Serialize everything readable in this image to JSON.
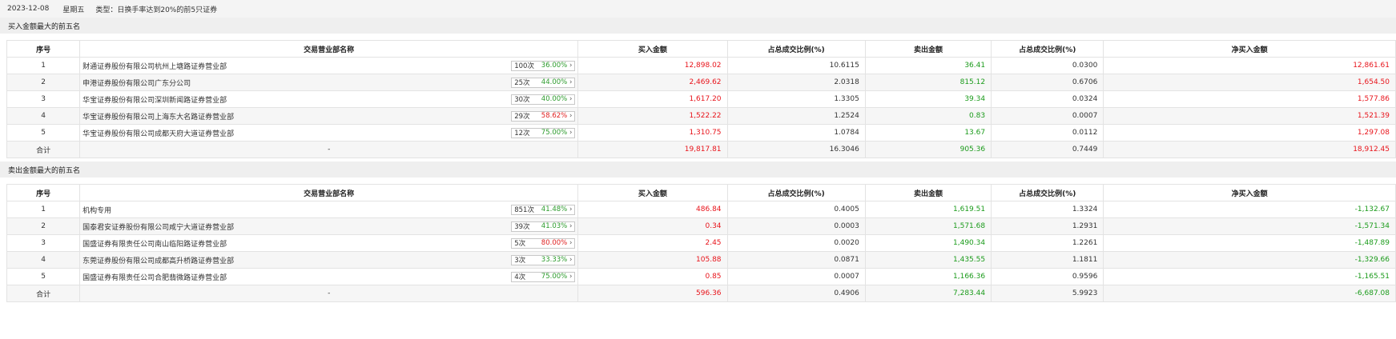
{
  "header": {
    "date": "2023-12-08",
    "weekday": "星期五",
    "type_label": "类型：",
    "type_value": "日换手率达到20%的前5只证券"
  },
  "columns": [
    "序号",
    "交易营业部名称",
    "买入金额",
    "占总成交比例(%)",
    "卖出金额",
    "占总成交比例(%)",
    "净买入金额"
  ],
  "buy": {
    "title": "买入金额最大的前五名",
    "rows": [
      {
        "idx": "1",
        "name": "财通证券股份有限公司杭州上塘路证券营业部",
        "count": "100次",
        "rate": "36.00%",
        "rate_color": "green",
        "buy": "12,898.02",
        "buy_pct": "10.6115",
        "sell": "36.41",
        "sell_pct": "0.0300",
        "net": "12,861.61",
        "net_color": "red"
      },
      {
        "idx": "2",
        "name": "申港证券股份有限公司广东分公司",
        "count": "25次",
        "rate": "44.00%",
        "rate_color": "green",
        "buy": "2,469.62",
        "buy_pct": "2.0318",
        "sell": "815.12",
        "sell_pct": "0.6706",
        "net": "1,654.50",
        "net_color": "red"
      },
      {
        "idx": "3",
        "name": "华宝证券股份有限公司深圳新闻路证券营业部",
        "count": "30次",
        "rate": "40.00%",
        "rate_color": "green",
        "buy": "1,617.20",
        "buy_pct": "1.3305",
        "sell": "39.34",
        "sell_pct": "0.0324",
        "net": "1,577.86",
        "net_color": "red"
      },
      {
        "idx": "4",
        "name": "华宝证券股份有限公司上海东大名路证券营业部",
        "count": "29次",
        "rate": "58.62%",
        "rate_color": "red",
        "buy": "1,522.22",
        "buy_pct": "1.2524",
        "sell": "0.83",
        "sell_pct": "0.0007",
        "net": "1,521.39",
        "net_color": "red"
      },
      {
        "idx": "5",
        "name": "华宝证券股份有限公司成都天府大道证券营业部",
        "count": "12次",
        "rate": "75.00%",
        "rate_color": "green",
        "buy": "1,310.75",
        "buy_pct": "1.0784",
        "sell": "13.67",
        "sell_pct": "0.0112",
        "net": "1,297.08",
        "net_color": "red"
      }
    ],
    "total": {
      "label": "合计",
      "name": "-",
      "buy": "19,817.81",
      "buy_pct": "16.3046",
      "sell": "905.36",
      "sell_pct": "0.7449",
      "net": "18,912.45",
      "net_color": "red"
    }
  },
  "sell": {
    "title": "卖出金额最大的前五名",
    "rows": [
      {
        "idx": "1",
        "name": "机构专用",
        "count": "851次",
        "rate": "41.48%",
        "rate_color": "green",
        "buy": "486.84",
        "buy_pct": "0.4005",
        "sell": "1,619.51",
        "sell_pct": "1.3324",
        "net": "-1,132.67",
        "net_color": "green"
      },
      {
        "idx": "2",
        "name": "国泰君安证券股份有限公司咸宁大道证券营业部",
        "count": "39次",
        "rate": "41.03%",
        "rate_color": "green",
        "buy": "0.34",
        "buy_pct": "0.0003",
        "sell": "1,571.68",
        "sell_pct": "1.2931",
        "net": "-1,571.34",
        "net_color": "green"
      },
      {
        "idx": "3",
        "name": "国盛证券有限责任公司南山临阳路证券营业部",
        "count": "5次",
        "rate": "80.00%",
        "rate_color": "red",
        "buy": "2.45",
        "buy_pct": "0.0020",
        "sell": "1,490.34",
        "sell_pct": "1.2261",
        "net": "-1,487.89",
        "net_color": "green"
      },
      {
        "idx": "4",
        "name": "东莞证券股份有限公司成都高升桥路证券营业部",
        "count": "3次",
        "rate": "33.33%",
        "rate_color": "green",
        "buy": "105.88",
        "buy_pct": "0.0871",
        "sell": "1,435.55",
        "sell_pct": "1.1811",
        "net": "-1,329.66",
        "net_color": "green"
      },
      {
        "idx": "5",
        "name": "国盛证券有限责任公司合肥翡微路证券营业部",
        "count": "4次",
        "rate": "75.00%",
        "rate_color": "green",
        "buy": "0.85",
        "buy_pct": "0.0007",
        "sell": "1,166.36",
        "sell_pct": "0.9596",
        "net": "-1,165.51",
        "net_color": "green"
      }
    ],
    "total": {
      "label": "合计",
      "name": "-",
      "buy": "596.36",
      "buy_pct": "0.4906",
      "sell": "7,283.44",
      "sell_pct": "5.9923",
      "net": "-6,687.08",
      "net_color": "green"
    }
  },
  "icons": {
    "badge_arrow": "chevron-right-icon"
  }
}
